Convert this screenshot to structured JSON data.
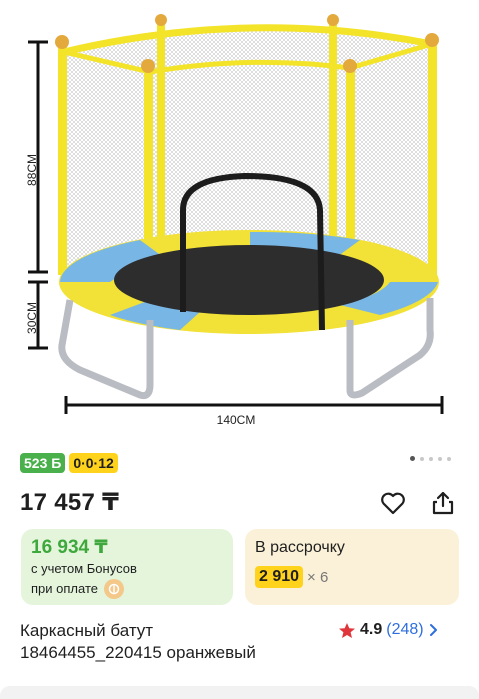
{
  "image": {
    "dim_height": "88СМ",
    "dim_legs": "30СМ",
    "dim_width": "140CM"
  },
  "badges": {
    "bonus": "523 Б",
    "installment": "0·0·12"
  },
  "price": "17 457 ₸",
  "icons": [
    "heart-icon",
    "share-icon",
    "kaspi-coin-icon",
    "star-icon",
    "chevron-right-icon"
  ],
  "bonus_card": {
    "price": "16 934 ₸",
    "line1": "с учетом Бонусов",
    "line2": "при оплате"
  },
  "installment_card": {
    "label": "В рассрочку",
    "amount": "2 910",
    "multiplier": "× 6"
  },
  "product": {
    "title_line1": "Каркасный батут",
    "title_line2": "18464455_220415 оранжевый"
  },
  "rating": {
    "value": "4.9",
    "count": "(248)"
  },
  "colors": {
    "accent_yellow": "#ffd31c",
    "bonus_green": "#3ea83c",
    "link_blue": "#2f6fdd",
    "star_red": "#e0353a"
  }
}
